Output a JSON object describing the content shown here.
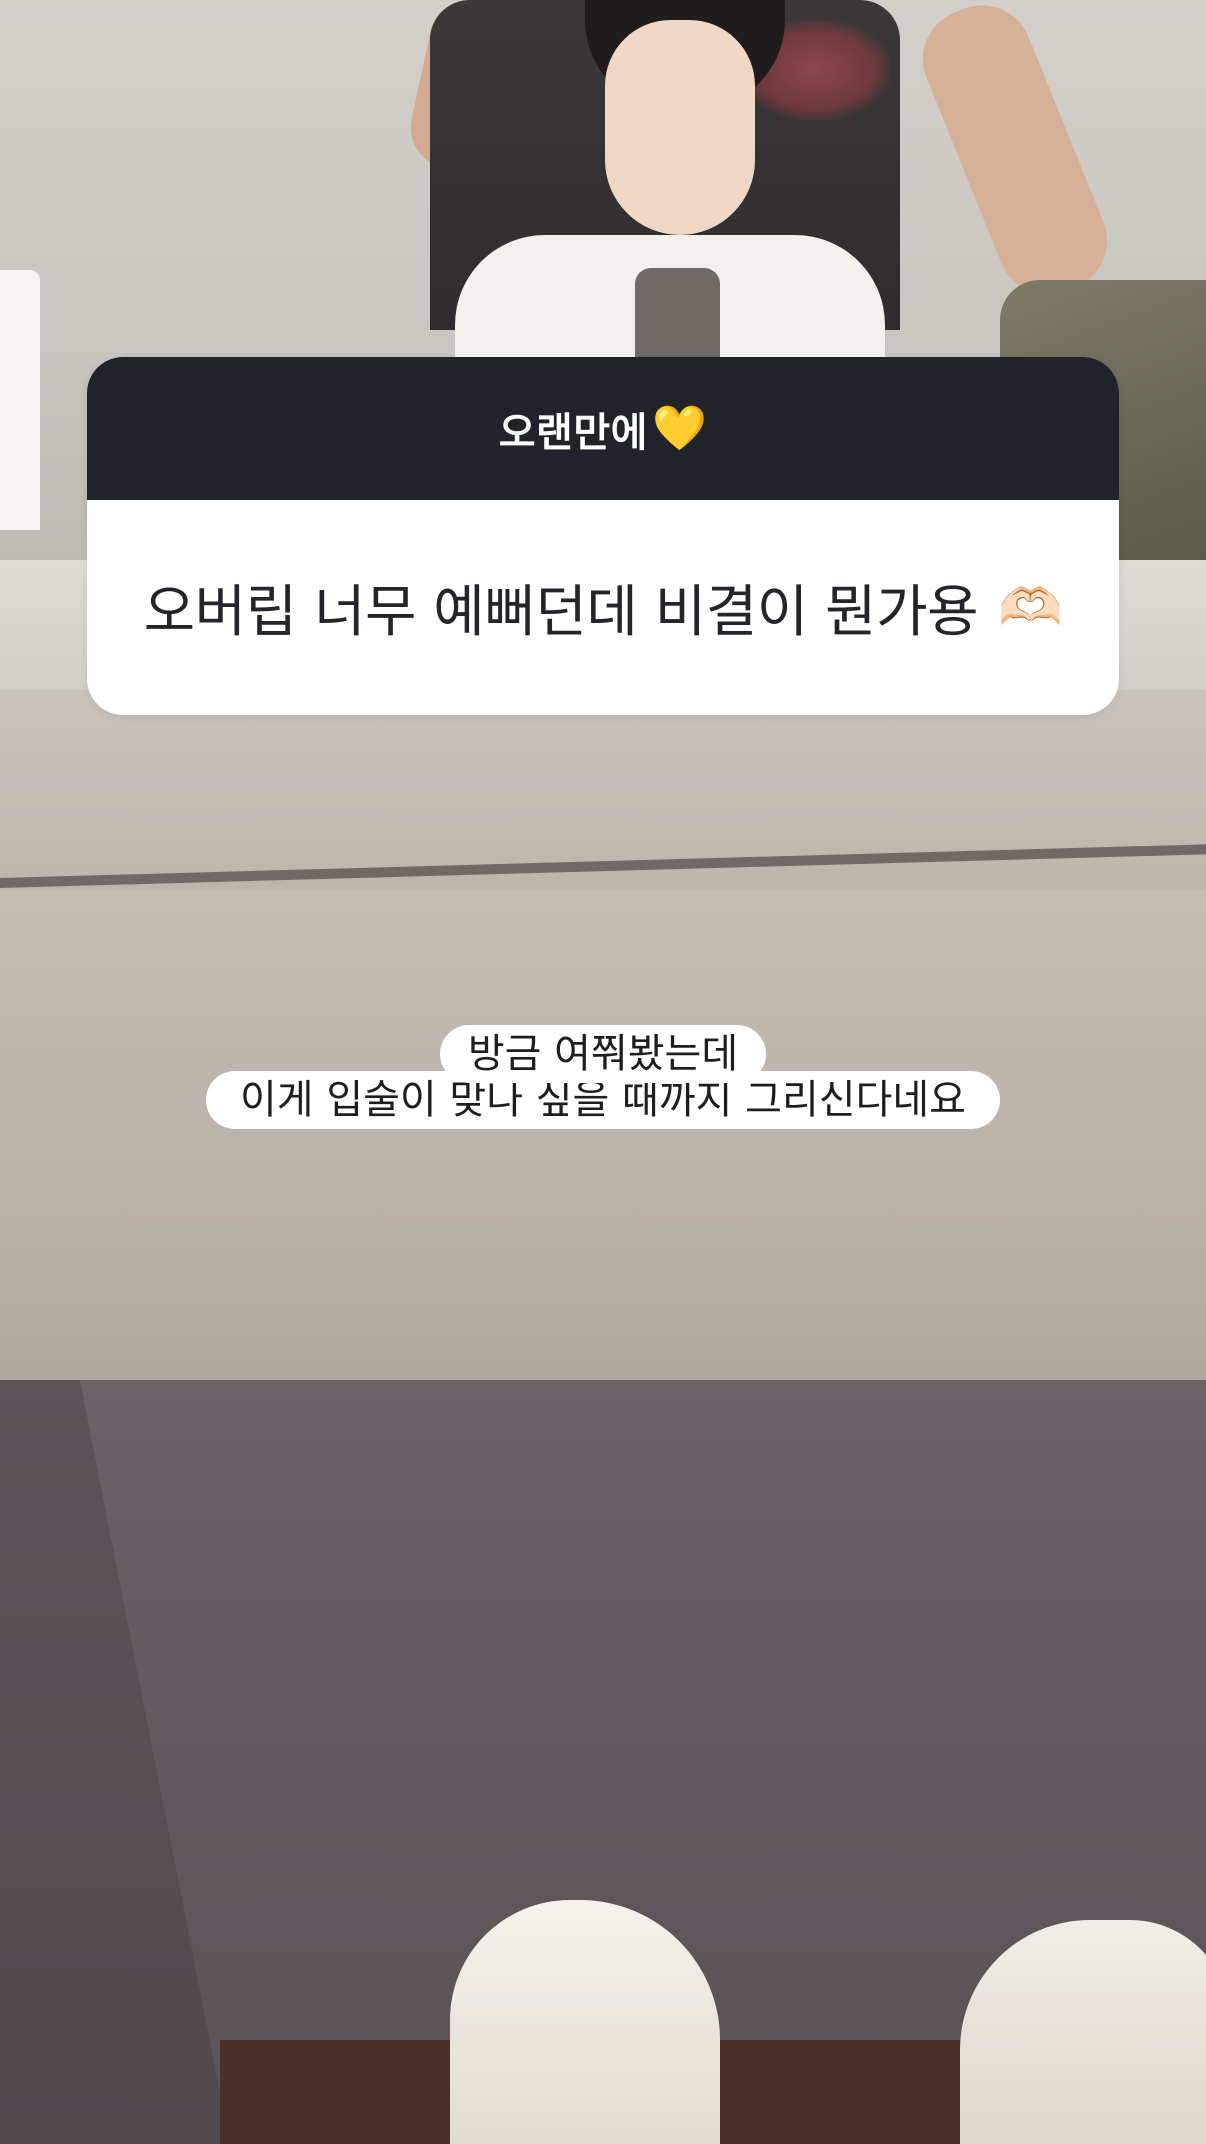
{
  "question_sticker": {
    "header": "오랜만에",
    "header_emoji": "💛",
    "question": "오버립 너무 예뻐던데 비결이 뭔가용",
    "question_emoji": "🫶🏻"
  },
  "answer_text": {
    "line1": "방금 여쭤봤는데",
    "line2": "이게 입술이 맞나 싶을 때까지 그리신다네요"
  },
  "colors": {
    "header_bg": "#20232a",
    "card_bg": "#ffffff",
    "text_dark": "#23252b"
  }
}
